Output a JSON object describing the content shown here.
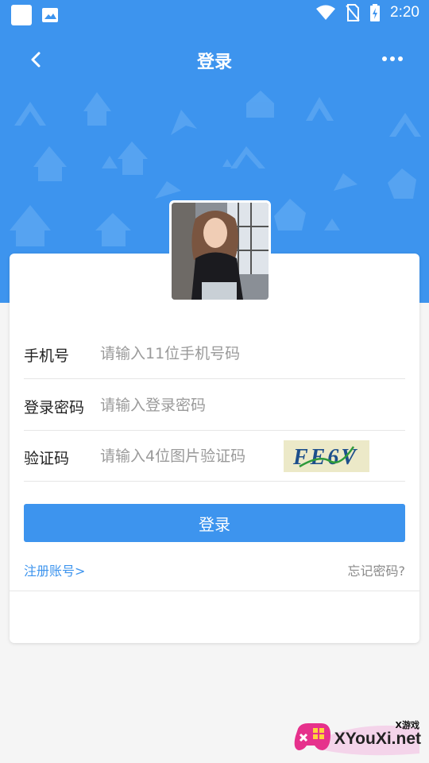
{
  "status_bar": {
    "time": "2:20"
  },
  "app_bar": {
    "title": "登录"
  },
  "form": {
    "phone": {
      "label": "手机号",
      "placeholder": "请输入11位手机号码"
    },
    "password": {
      "label": "登录密码",
      "placeholder": "请输入登录密码"
    },
    "captcha": {
      "label": "验证码",
      "placeholder": "请输入4位图片验证码",
      "image_text": "FE6V"
    }
  },
  "actions": {
    "login_label": "登录",
    "register_label": "注册账号>",
    "forgot_label": "忘记密码?"
  },
  "watermark": {
    "small": "X游戏",
    "brand": "XYouXi.net"
  },
  "colors": {
    "primary": "#3d94ee",
    "background": "#f5f5f5"
  }
}
